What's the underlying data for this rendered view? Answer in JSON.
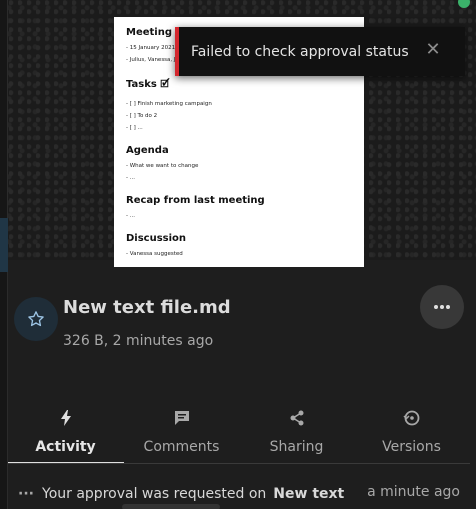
{
  "preview": {
    "sections": [
      {
        "heading": "Meeting",
        "items": [
          "- 15 January 2021,",
          "- Julius, Vanessa, J"
        ]
      },
      {
        "heading": "Tasks 🗹",
        "items": [
          "- [ ] Finish marketing campaign",
          "- [ ] To do 2",
          "- [ ] ..."
        ]
      },
      {
        "heading": "Agenda",
        "items": [
          "- What we want to change",
          "- ..."
        ]
      },
      {
        "heading": "Recap from last meeting",
        "items": [
          "- ..."
        ]
      },
      {
        "heading": "Discussion",
        "items": [
          "- Vanessa suggested"
        ]
      }
    ]
  },
  "toast": {
    "message": "Failed to check approval status",
    "close_symbol": "✕"
  },
  "file": {
    "name": "New text file.md",
    "meta": "326 B, 2 minutes ago"
  },
  "tabs": [
    {
      "label": "Activity",
      "icon": "flash-icon",
      "active": true
    },
    {
      "label": "Comments",
      "icon": "comment-icon",
      "active": false
    },
    {
      "label": "Sharing",
      "icon": "share-icon",
      "active": false
    },
    {
      "label": "Versions",
      "icon": "history-icon",
      "active": false
    }
  ],
  "activity": {
    "message": "Your approval was requested on",
    "target": "New text",
    "time": "a minute ago"
  },
  "colors": {
    "error": "#d4272e",
    "online": "#3bb26a",
    "background": "#1e1e1e"
  }
}
